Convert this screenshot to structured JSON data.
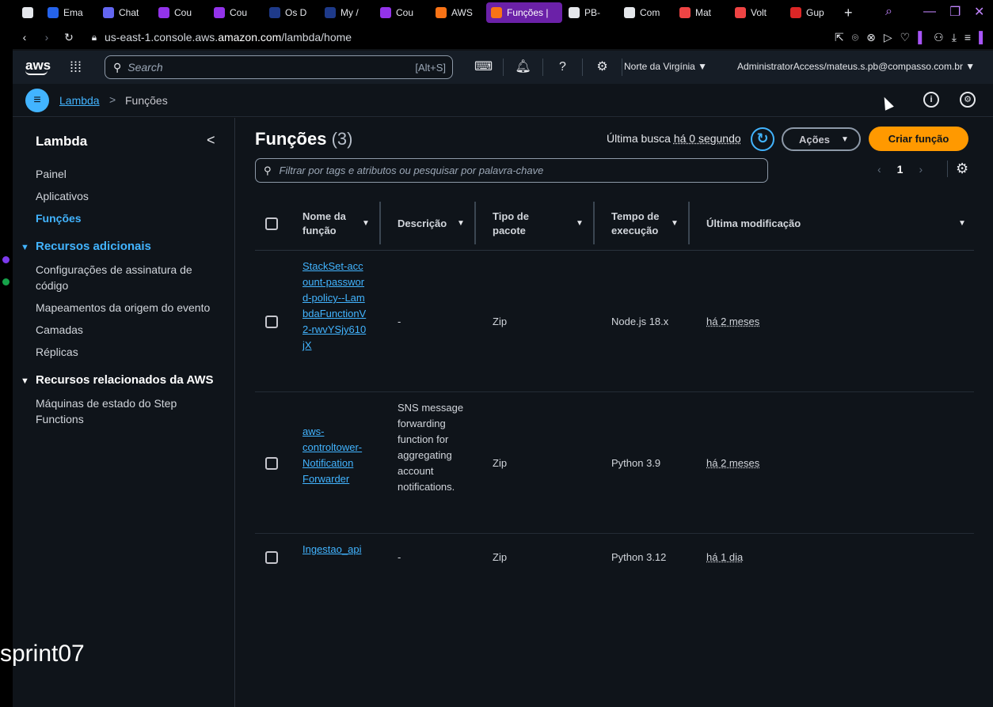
{
  "browser": {
    "tabs": [
      {
        "label": "",
        "icon": "vpn-icon",
        "color": "#e5e7eb"
      },
      {
        "label": "Ema",
        "icon": "outlook-icon",
        "color": "#2563eb"
      },
      {
        "label": "Chat",
        "icon": "teams-icon",
        "color": "#6366f1"
      },
      {
        "label": "Cou",
        "icon": "course-icon",
        "color": "#9333ea"
      },
      {
        "label": "Cou",
        "icon": "course-icon",
        "color": "#9333ea"
      },
      {
        "label": "Os D",
        "icon": "doc-icon",
        "color": "#1e3a8a"
      },
      {
        "label": "My /",
        "icon": "doc-icon",
        "color": "#1e3a8a"
      },
      {
        "label": "Cou",
        "icon": "course-icon",
        "color": "#9333ea"
      },
      {
        "label": "AWS",
        "icon": "aws-icon",
        "color": "#f97316"
      },
      {
        "label": "Funções |",
        "icon": "lambda-icon",
        "color": "#f97316",
        "active": true
      },
      {
        "label": "PB-",
        "icon": "github-icon",
        "color": "#e5e7eb"
      },
      {
        "label": "Com",
        "icon": "github-icon",
        "color": "#e5e7eb"
      },
      {
        "label": "Mat",
        "icon": "gmail-icon",
        "color": "#ef4444"
      },
      {
        "label": "Volt",
        "icon": "gmail-icon",
        "color": "#ef4444"
      },
      {
        "label": "Gup",
        "icon": "profile-icon",
        "color": "#dc2626"
      }
    ],
    "new_tab": "+",
    "url_prefix": "us-east-1.console.aws.",
    "url_domain": "amazon.com",
    "url_path": "/lambda/home"
  },
  "aws_nav": {
    "logo": "aws",
    "search_placeholder": "Search",
    "search_shortcut": "[Alt+S]",
    "region": "Norte da Virgínia ▼",
    "account": "AdministratorAccess/mateus.s.pb@compasso.com.br ▼"
  },
  "breadcrumb": {
    "root": "Lambda",
    "separator": ">",
    "current": "Funções"
  },
  "sidebar": {
    "title": "Lambda",
    "collapse": "<",
    "items": [
      "Painel",
      "Aplicativos",
      "Funções"
    ],
    "section1": {
      "title": "Recursos adicionais",
      "items": [
        "Configurações de assinatura de código",
        "Mapeamentos da origem do evento",
        "Camadas",
        "Réplicas"
      ]
    },
    "section2": {
      "title": "Recursos relacionados da AWS",
      "items": [
        "Máquinas de estado do Step Functions"
      ]
    }
  },
  "main": {
    "title": "Funções",
    "count": "(3)",
    "last_search_label": "Última busca",
    "last_search_value": "há 0 segundo",
    "actions_label": "Ações",
    "create_label": "Criar função",
    "filter_placeholder": "Filtrar por tags e atributos ou pesquisar por palavra-chave",
    "page": "1",
    "columns": [
      "Nome da função",
      "Descrição",
      "Tipo de pacote",
      "Tempo de execução",
      "Última modificação"
    ],
    "rows": [
      {
        "name": "StackSet-account-password-policy--LambdaFunctionV2-rwvYSjy610jX",
        "description": "-",
        "package": "Zip",
        "runtime": "Node.js 18.x",
        "modified": "há 2 meses"
      },
      {
        "name": "aws-controltower-Notification Forwarder",
        "description": "SNS message forwarding function for aggregating account notifications.",
        "package": "Zip",
        "runtime": "Python 3.9",
        "modified": "há 2 meses"
      },
      {
        "name": "Ingestao_api",
        "description": "-",
        "package": "Zip",
        "runtime": "Python 3.12",
        "modified": "há 1 dia"
      }
    ]
  },
  "overlay": {
    "text": "sprint07"
  },
  "colors": {
    "accent": "#42b4ff",
    "primary_button": "#ff9900",
    "background": "#0f141a"
  }
}
